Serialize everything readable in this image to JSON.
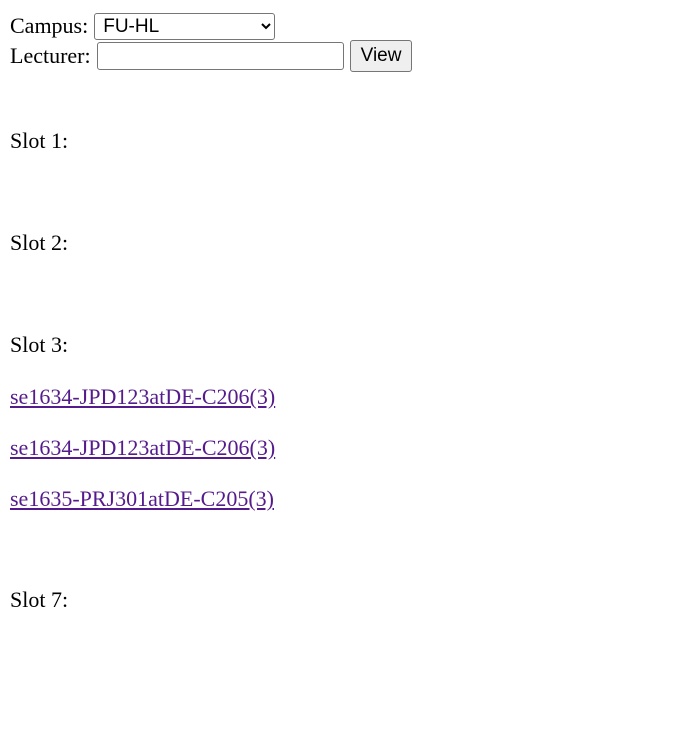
{
  "form": {
    "campus_label": "Campus:",
    "campus_value": "FU-HL",
    "campus_options": [
      "FU-HL"
    ],
    "lecturer_label": "Lecturer:",
    "lecturer_value": "",
    "lecturer_placeholder": "",
    "view_label": "View"
  },
  "slots": [
    {
      "label": "Slot 1:",
      "links": []
    },
    {
      "label": "Slot 2:",
      "links": []
    },
    {
      "label": "Slot 3:",
      "links": [
        "se1634-JPD123atDE-C206(3)",
        "se1634-JPD123atDE-C206(3)",
        "se1635-PRJ301atDE-C205(3)"
      ]
    },
    {
      "label": "Slot 7:",
      "links": []
    }
  ],
  "colors": {
    "link_visited": "#551a8b",
    "text": "#000000",
    "button_bg": "#efefef",
    "border": "#767676"
  }
}
